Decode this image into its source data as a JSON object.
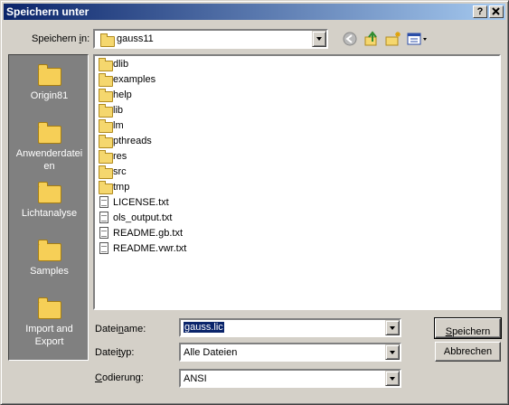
{
  "window": {
    "title": "Speichern unter",
    "help_btn": "?",
    "close_btn": "X"
  },
  "save_in": {
    "label_pre": "Speichern ",
    "label_u": "i",
    "label_post": "n:",
    "value": "gauss11"
  },
  "toolbar": {
    "icons": [
      "back-arrow-icon",
      "up-folder-icon",
      "new-folder-icon",
      "view-menu-icon"
    ]
  },
  "places": [
    {
      "label": "Origin81",
      "icon": "folder-icon"
    },
    {
      "label": "Anwenderdatei",
      "label2": "en",
      "icon": "folder-icon"
    },
    {
      "label": "Lichtanalyse",
      "icon": "folder-icon"
    },
    {
      "label": "Samples",
      "icon": "folder-icon"
    },
    {
      "label": "Import and",
      "label2": "Export",
      "icon": "folder-icon"
    }
  ],
  "files": [
    {
      "name": "dlib",
      "type": "folder"
    },
    {
      "name": "examples",
      "type": "folder"
    },
    {
      "name": "help",
      "type": "folder"
    },
    {
      "name": "lib",
      "type": "folder"
    },
    {
      "name": "lm",
      "type": "folder"
    },
    {
      "name": "pthreads",
      "type": "folder"
    },
    {
      "name": "res",
      "type": "folder"
    },
    {
      "name": "src",
      "type": "folder"
    },
    {
      "name": "tmp",
      "type": "folder"
    },
    {
      "name": "LICENSE.txt",
      "type": "file"
    },
    {
      "name": "ols_output.txt",
      "type": "file"
    },
    {
      "name": "README.gb.txt",
      "type": "file"
    },
    {
      "name": "README.vwr.txt",
      "type": "file"
    }
  ],
  "filename": {
    "label_pre": "Datei",
    "label_u": "n",
    "label_post": "ame:",
    "value": "gauss.lic"
  },
  "filetype": {
    "label_pre": "Datei",
    "label_u": "t",
    "label_post": "yp:",
    "value": "Alle Dateien"
  },
  "encoding": {
    "label_u": "C",
    "label_post": "odierung:",
    "value": "ANSI"
  },
  "buttons": {
    "save": "Speichern",
    "save_u": "S",
    "save_rest": "peichern",
    "cancel": "Abbrechen"
  }
}
